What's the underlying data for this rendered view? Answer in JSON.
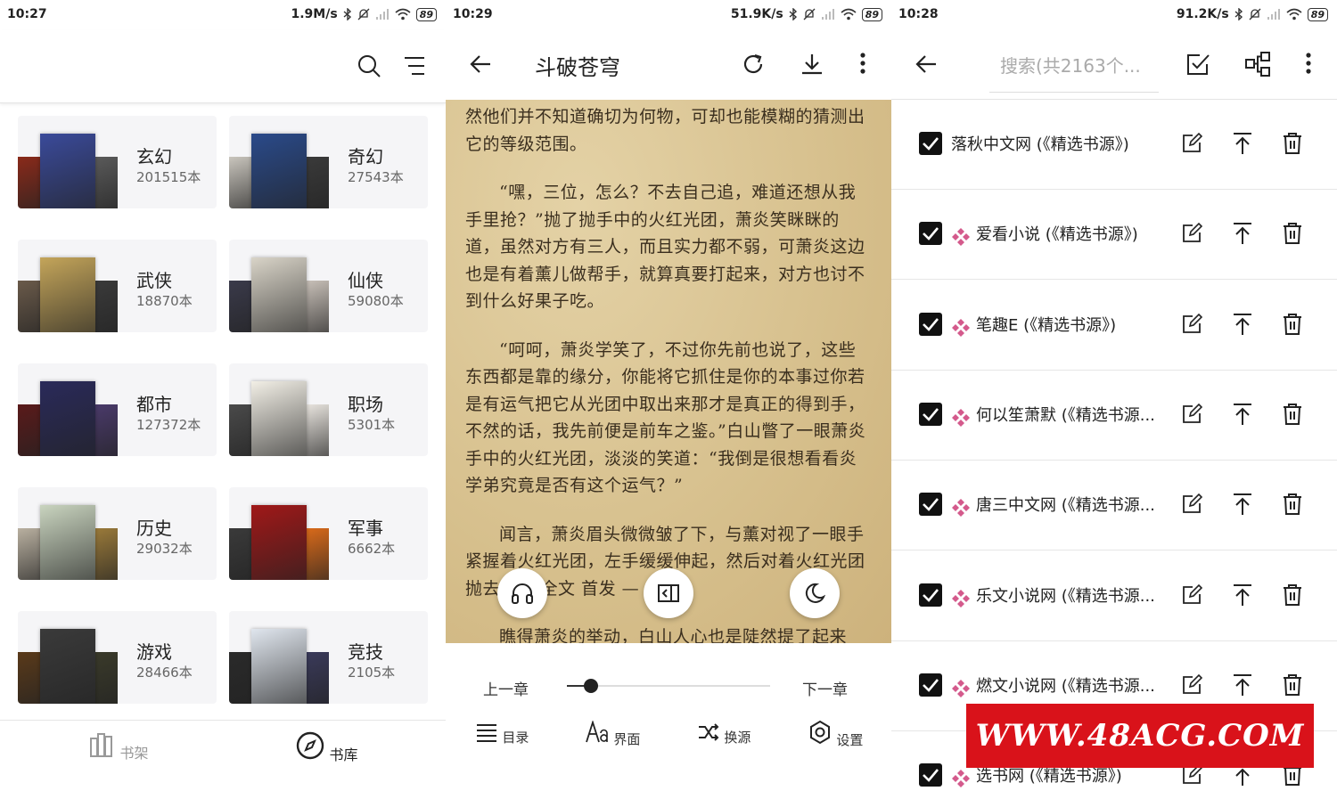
{
  "screen1": {
    "status": {
      "time": "10:27",
      "speed": "1.9M/s",
      "battery": "89"
    },
    "categories": [
      {
        "name": "玄幻",
        "count": "201515本",
        "colors": [
          "#8a2a1a",
          "#3a4a9a",
          "#5a5a5a"
        ]
      },
      {
        "name": "奇幻",
        "count": "27543本",
        "colors": [
          "#c9c5bd",
          "#2a4a8a",
          "#3a3a3a"
        ]
      },
      {
        "name": "武侠",
        "count": "18870本",
        "colors": [
          "#6a5a4a",
          "#c4a55a",
          "#3a3a3a"
        ]
      },
      {
        "name": "仙侠",
        "count": "59080本",
        "colors": [
          "#3a3a4a",
          "#d9d4c8",
          "#c8c0b8"
        ]
      },
      {
        "name": "都市",
        "count": "127372本",
        "colors": [
          "#5a1a1a",
          "#2a2a5a",
          "#4a3a6a"
        ]
      },
      {
        "name": "职场",
        "count": "5301本",
        "colors": [
          "#4a4a4a",
          "#f2efe6",
          "#e8e4de"
        ]
      },
      {
        "name": "历史",
        "count": "29032本",
        "colors": [
          "#b9b0a0",
          "#c9d4bf",
          "#9a7a3a"
        ]
      },
      {
        "name": "军事",
        "count": "6662本",
        "colors": [
          "#3a3a3a",
          "#a01818",
          "#d96a1a"
        ]
      },
      {
        "name": "游戏",
        "count": "28466本",
        "colors": [
          "#5a3a1a",
          "#3a3a3a",
          "#3a3a2a"
        ]
      },
      {
        "name": "竞技",
        "count": "2105本",
        "colors": [
          "#2a2a2a",
          "#e0e6ee",
          "#3a3a5a"
        ]
      }
    ],
    "nav": {
      "shelf": "书架",
      "library": "书库"
    }
  },
  "screen2": {
    "status": {
      "time": "10:29",
      "speed": "51.9K/s",
      "battery": "89"
    },
    "title": "斗破苍穹",
    "paragraphs": [
      "然他们并不知道确切为何物，可却也能模糊的猜测出它的等级范围。",
      "“嘿，三位，怎么？不去自己追，难道还想从我手里抢？”抛了抛手中的火红光团，萧炎笑眯眯的道，虽然对方有三人，而且实力都不弱，可萧炎这边也是有着薰儿做帮手，就算真要打起来，对方也讨不到什么好果子吃。",
      "“呵呵，萧炎学笑了，不过你先前也说了，这些东西都是靠的缘分，你能将它抓住是你的本事过你若是有运气把它从光团中取出来那才是真正的得到手，不然的话，我先前便是前车之鉴。”白山瞥了一眼萧炎手中的火红光团，淡淡的笑道：“我倒是很想看看炎学弟究竟是否有这个运气？”",
      "闻言，萧炎眉头微微皱了下，与薰对视了一眼手紧握着火红光团，左手缓缓伸起，然后对着火红光团抛去。— 全文 首发 —",
      "瞧得萧炎的举动，白山人心也是陡然提了起来"
    ],
    "prev_chapter": "上一章",
    "next_chapter": "下一章",
    "progress": 0.12,
    "tools": {
      "toc": "目录",
      "ui": "界面",
      "source": "换源",
      "settings": "设置"
    }
  },
  "screen3": {
    "status": {
      "time": "10:28",
      "speed": "91.2K/s",
      "battery": "89"
    },
    "search_placeholder": "搜索(共2163个...",
    "sources": [
      {
        "label": "落秋中文网 (《精选书源》)",
        "diamond": false
      },
      {
        "label": "爱看小说 (《精选书源》)",
        "diamond": true
      },
      {
        "label": "笔趣E (《精选书源》)",
        "diamond": true
      },
      {
        "label": "何以笙萧默 (《精选书源...",
        "diamond": true
      },
      {
        "label": "唐三中文网 (《精选书源...",
        "diamond": true
      },
      {
        "label": "乐文小说网 (《精选书源...",
        "diamond": true
      },
      {
        "label": "燃文小说网 (《精选书源...",
        "diamond": true
      },
      {
        "label": "选书网 (《精选书源》)",
        "diamond": true
      }
    ],
    "watermark": "WWW.48ACG.COM"
  },
  "colors": {
    "diamond": "#d45a8c",
    "reader_bg": "#dcc79a",
    "watermark_bg": "#d9121a"
  }
}
